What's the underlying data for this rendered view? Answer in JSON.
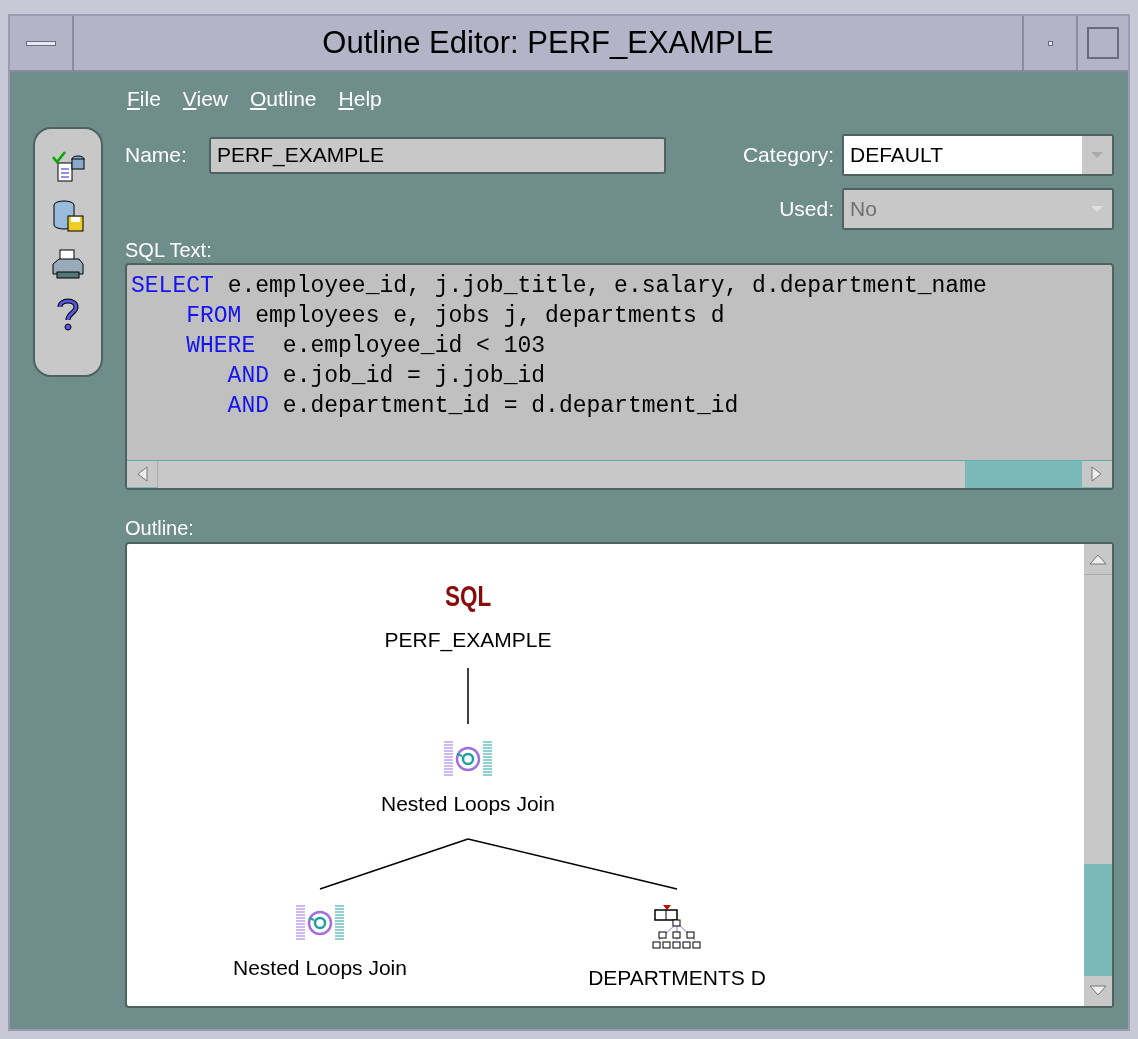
{
  "window": {
    "title": "Outline Editor: PERF_EXAMPLE"
  },
  "menu": [
    {
      "label": "File"
    },
    {
      "label": "View"
    },
    {
      "label": "Outline"
    },
    {
      "label": "Help"
    }
  ],
  "fields": {
    "name": {
      "label": "Name:",
      "value": "PERF_EXAMPLE"
    },
    "category": {
      "label": "Category:",
      "value": "DEFAULT",
      "disabled": false
    },
    "used": {
      "label": "Used:",
      "value": "No",
      "disabled": true
    }
  },
  "sql_text": {
    "label": "SQL Text:",
    "lines": [
      [
        {
          "kind": "keyword",
          "text": "SELECT"
        },
        {
          "kind": "plain",
          "text": " e.employee_id, j.job_title, e.salary, d.department_name"
        }
      ],
      [
        {
          "kind": "keyword",
          "text": "    FROM"
        },
        {
          "kind": "plain",
          "text": " employees e, jobs j, departments d"
        }
      ],
      [
        {
          "kind": "keyword",
          "text": "    WHERE"
        },
        {
          "kind": "plain",
          "text": "  e.employee_id < 103"
        }
      ],
      [
        {
          "kind": "keyword",
          "text": "       AND"
        },
        {
          "kind": "plain",
          "text": " e.job_id = j.job_id"
        }
      ],
      [
        {
          "kind": "keyword",
          "text": "       AND"
        },
        {
          "kind": "plain",
          "text": " e.department_id = d.department_id"
        }
      ]
    ]
  },
  "outline": {
    "label": "Outline:",
    "root": {
      "kind": "statement",
      "icon_text": "SQL",
      "label": "PERF_EXAMPLE",
      "children": [
        {
          "kind": "join",
          "label": "Nested Loops Join",
          "children": [
            {
              "kind": "join",
              "label": "Nested Loops Join"
            },
            {
              "kind": "table",
              "label": "DEPARTMENTS D"
            }
          ]
        }
      ]
    }
  }
}
